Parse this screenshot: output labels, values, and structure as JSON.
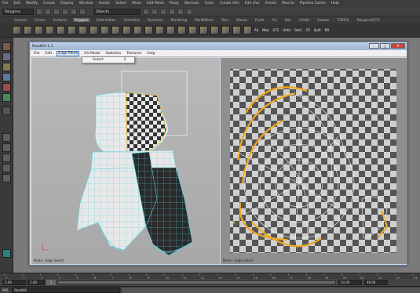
{
  "maya": {
    "menus": [
      "File",
      "Edit",
      "Modify",
      "Create",
      "Display",
      "Window",
      "Assets",
      "Select",
      "Mesh",
      "Edit Mesh",
      "Proxy",
      "Normals",
      "Color",
      "Create UVs",
      "Edit UVs",
      "Arnold",
      "Muscle",
      "Pipeline Cache",
      "Help"
    ],
    "mode": "Polygons",
    "objects_field": "Objects",
    "shelf_tabs": [
      "General",
      "Curves",
      "Surfaces",
      "Polygons",
      "Deformation",
      "Animation",
      "Dynamics",
      "Rendering",
      "PaintEffects",
      "Toon",
      "Muscle",
      "Fluids",
      "Fur",
      "Hair",
      "nCloth",
      "Custom",
      "TURTLE",
      "Polyspiral2572"
    ],
    "active_shelf_tab": "Polygons",
    "shelf_labels": [
      "All",
      "Mod",
      "UT2",
      "Unfd",
      "Out1",
      "CP",
      "Split",
      "RR"
    ],
    "timeline": {
      "start": "1.00",
      "start_field": "1.00",
      "current": "1",
      "end_field": "24.00",
      "end": "48.00",
      "tick_labels": [
        "1",
        "2",
        "3",
        "4",
        "5",
        "6",
        "7",
        "8",
        "9",
        "10",
        "11",
        "12",
        "13",
        "14",
        "15",
        "16",
        "17",
        "18",
        "19",
        "20",
        "21",
        "22",
        "23",
        "24"
      ]
    },
    "command_prefix": "MEL",
    "command_value": "RoadKill"
  },
  "roadkill": {
    "title": "RoadKill 1.1",
    "window_buttons": [
      "–",
      "□",
      "X"
    ],
    "menus": [
      "File",
      "Edit",
      "Edge Mode",
      "UV Mode",
      "Switches",
      "Textures",
      "Help"
    ],
    "open_menu": "Edge Mode",
    "dropdown": {
      "label": "Select",
      "shortcut": "E"
    },
    "status_3d": "Mode : Edge  Select",
    "status_uv": "Mode : Edge  Select"
  },
  "colors": {
    "seam": "#f0a820",
    "wire": "#5fd3e0",
    "mesh_dark": "#2c2c2c",
    "mesh_light": "#e6e6e6",
    "uv_dark": "#555555",
    "uv_light": "#cfcfcf"
  }
}
